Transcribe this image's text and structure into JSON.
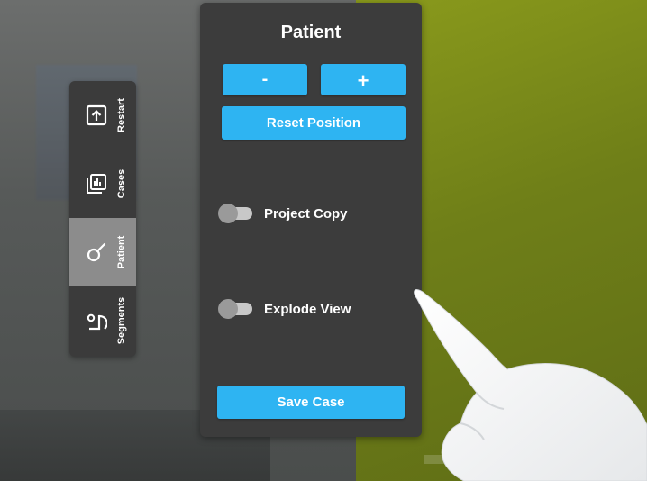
{
  "colors": {
    "accent": "#2eb4f2",
    "panel_bg": "#3c3c3c",
    "side_bar_bg": "#3b3b3b",
    "active_tab_bg": "#8c8c8c",
    "text": "#ffffff"
  },
  "side_tabs": [
    {
      "label": "Restart",
      "icon": "restart-icon",
      "active": false
    },
    {
      "label": "Cases",
      "icon": "cases-icon",
      "active": false
    },
    {
      "label": "Patient",
      "icon": "patient-icon",
      "active": true
    },
    {
      "label": "Segments",
      "icon": "segments-icon",
      "active": false
    }
  ],
  "panel": {
    "title": "Patient",
    "minus_label": "-",
    "plus_label": "+",
    "reset_label": "Reset Position",
    "toggles": [
      {
        "label": "Project Copy",
        "on": false
      },
      {
        "label": "Explode View",
        "on": false
      }
    ],
    "save_label": "Save Case"
  }
}
